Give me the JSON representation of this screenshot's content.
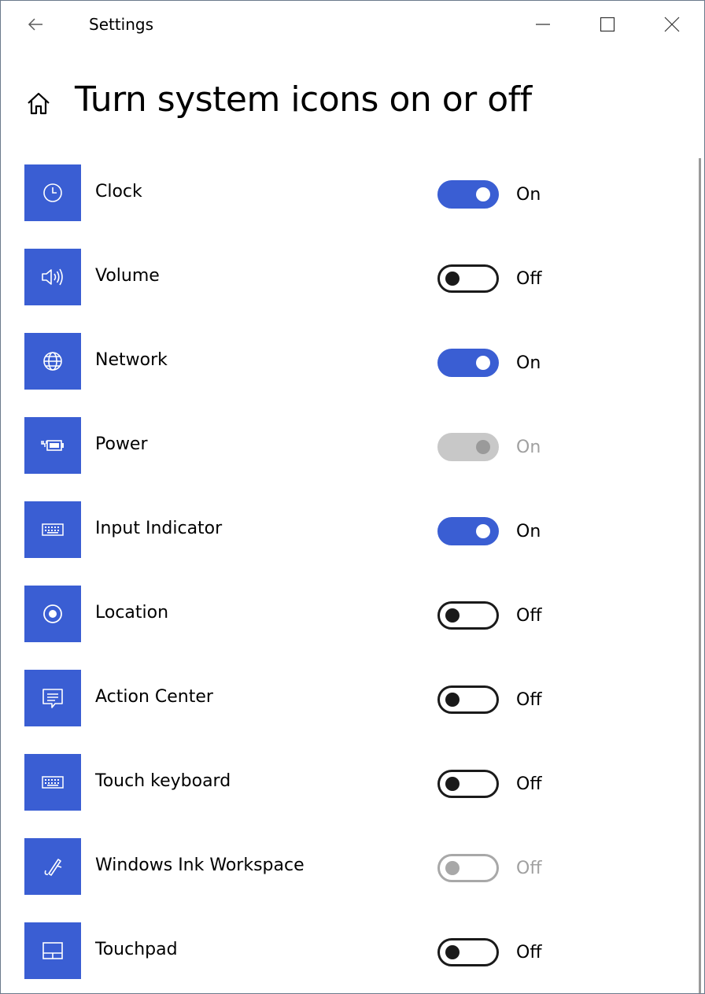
{
  "window": {
    "title": "Settings",
    "controls": {
      "minimize_icon": "minimize-icon",
      "maximize_icon": "maximize-icon",
      "close_icon": "close-icon"
    }
  },
  "page": {
    "title": "Turn system icons on or off",
    "home_icon": "home-icon"
  },
  "colors": {
    "accent": "#3a5ed3",
    "disabled": "#c8c8c8",
    "text": "#000000"
  },
  "items": [
    {
      "label": "Clock",
      "icon": "clock-icon",
      "state": "On",
      "enabled": true
    },
    {
      "label": "Volume",
      "icon": "volume-icon",
      "state": "Off",
      "enabled": true
    },
    {
      "label": "Network",
      "icon": "globe-icon",
      "state": "On",
      "enabled": true
    },
    {
      "label": "Power",
      "icon": "battery-icon",
      "state": "On",
      "enabled": false
    },
    {
      "label": "Input Indicator",
      "icon": "keyboard-icon",
      "state": "On",
      "enabled": true
    },
    {
      "label": "Location",
      "icon": "location-icon",
      "state": "Off",
      "enabled": true
    },
    {
      "label": "Action Center",
      "icon": "message-icon",
      "state": "Off",
      "enabled": true
    },
    {
      "label": "Touch keyboard",
      "icon": "keyboard-icon",
      "state": "Off",
      "enabled": true
    },
    {
      "label": "Windows Ink Workspace",
      "icon": "pen-icon",
      "state": "Off",
      "enabled": false
    },
    {
      "label": "Touchpad",
      "icon": "touchpad-icon",
      "state": "Off",
      "enabled": true
    }
  ]
}
